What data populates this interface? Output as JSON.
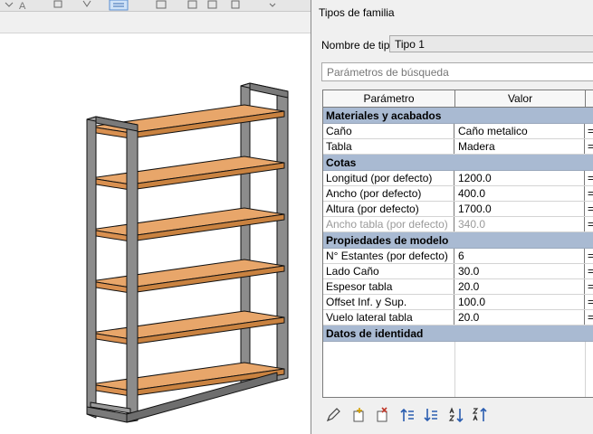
{
  "dialog": {
    "title": "Tipos de familia",
    "type_name_label": "Nombre de tipo:",
    "type_name_value": "Tipo 1",
    "search_placeholder": "Parámetros de búsqueda"
  },
  "table": {
    "headers": [
      "Parámetro",
      "Valor"
    ],
    "groups": [
      {
        "name": "Materiales y acabados",
        "rows": [
          {
            "param": "Caño",
            "value": "Caño metalico",
            "formula": "="
          },
          {
            "param": "Tabla",
            "value": "Madera",
            "formula": "="
          }
        ]
      },
      {
        "name": "Cotas",
        "rows": [
          {
            "param": "Longitud (por defecto)",
            "value": "1200.0",
            "formula": "="
          },
          {
            "param": "Ancho (por defecto)",
            "value": "400.0",
            "formula": "="
          },
          {
            "param": "Altura (por defecto)",
            "value": "1700.0",
            "formula": "="
          },
          {
            "param": "Ancho tabla (por defecto)",
            "value": "340.0",
            "formula": "="
          }
        ]
      },
      {
        "name": "Propiedades de modelo",
        "rows": [
          {
            "param": "N° Estantes (por defecto)",
            "value": "6",
            "formula": "="
          },
          {
            "param": "Lado Caño",
            "value": "30.0",
            "formula": "="
          },
          {
            "param": "Espesor tabla",
            "value": "20.0",
            "formula": "="
          },
          {
            "param": "Offset Inf. y Sup.",
            "value": "100.0",
            "formula": "="
          },
          {
            "param": "Vuelo lateral tabla",
            "value": "20.0",
            "formula": "="
          }
        ]
      },
      {
        "name": "Datos de identidad",
        "rows": []
      }
    ]
  },
  "toolbar_icons": [
    "pencil-icon",
    "new-type-icon",
    "delete-type-icon",
    "move-up-icon",
    "move-down-icon",
    "sort-ascending-icon",
    "sort-descending-icon"
  ],
  "model": {
    "shelf_count": 6,
    "frame_color": "#8c8c8c",
    "shelf_color": "#e8a66a"
  },
  "colors": {
    "group_header": "#a9bad2",
    "dialog_bg": "#f0f0f0"
  }
}
